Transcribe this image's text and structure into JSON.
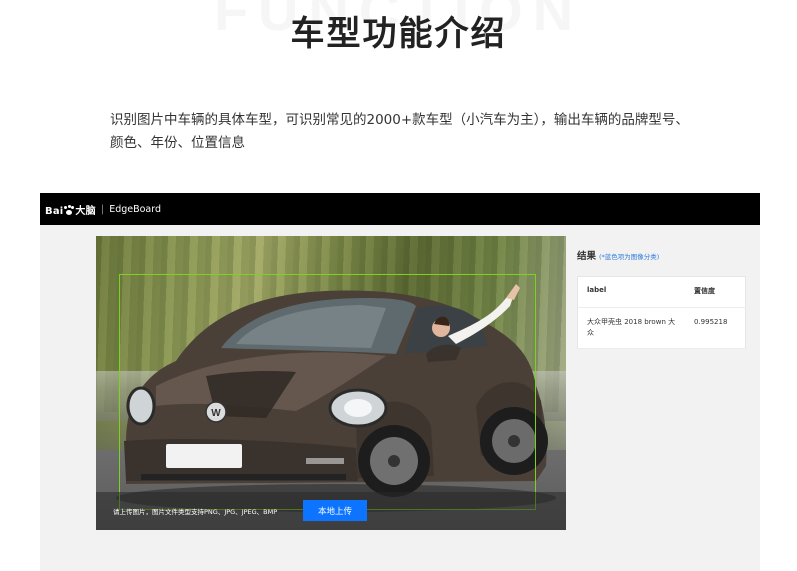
{
  "watermark": "FUNCTION",
  "page_title": "车型功能介绍",
  "intro": {
    "line1": "识别图片中车辆的具体车型，可识别常见的2000+款车型（小汽车为主），输出车辆的品牌型号、",
    "line2": "颜色、年份、位置信息"
  },
  "demo": {
    "header": {
      "logo_prefix": "Bai",
      "logo_suffix": "大脑",
      "separator": "|",
      "product": "EdgeBoard"
    },
    "upload": {
      "hint": "请上传图片，图片文件类型支持PNG、JPG、JPEG、BMP",
      "button_label": "本地上传"
    },
    "detection_box_color": "#7ad41e",
    "result": {
      "title": "结果",
      "note": "(*蓝色项为图像分类)",
      "columns": [
        "label",
        "置信度"
      ],
      "rows": [
        {
          "label": "大众甲壳虫 2018 brown 大众",
          "confidence": "0.995218"
        }
      ]
    }
  },
  "colors": {
    "accent": "#0d74ff",
    "header_bg": "#000000",
    "panel_bg": "#f2f2f2"
  }
}
